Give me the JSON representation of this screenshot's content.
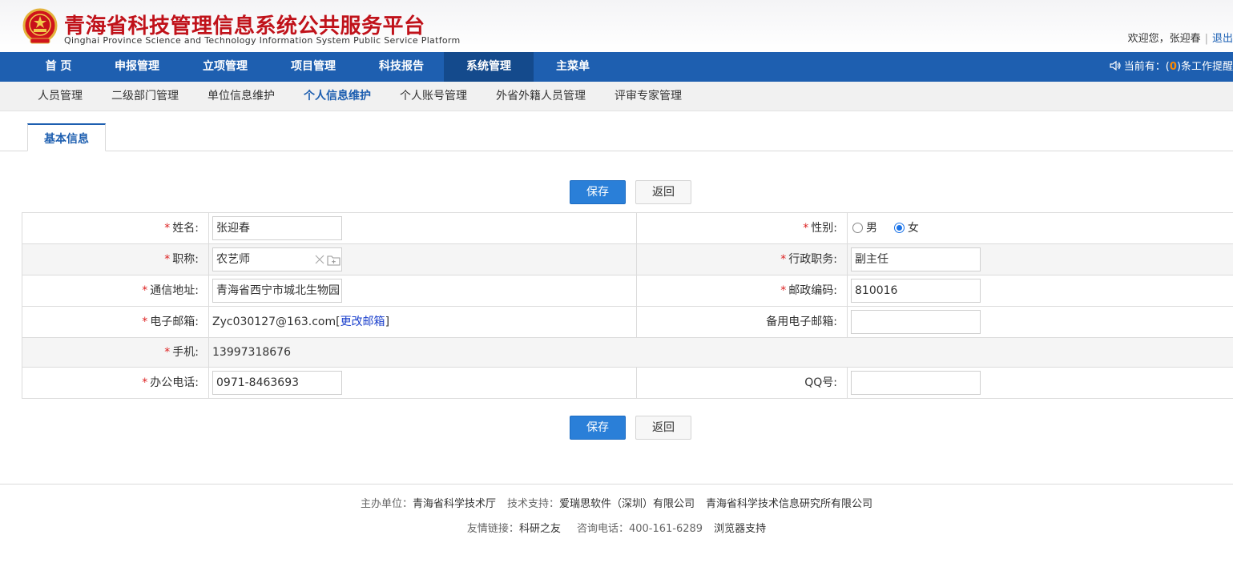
{
  "header": {
    "brand_cn": "青海省科技管理信息系统公共服务平台",
    "brand_en": "Qinghai Province Science and Technology Information System Public Service Platform",
    "welcome": "欢迎您，张迎春",
    "logout": "退出"
  },
  "main_nav": [
    {
      "label": "首 页"
    },
    {
      "label": "申报管理"
    },
    {
      "label": "立项管理"
    },
    {
      "label": "项目管理"
    },
    {
      "label": "科技报告"
    },
    {
      "label": "系统管理",
      "active": true
    },
    {
      "label": "主菜单"
    }
  ],
  "notice": {
    "prefix": "当前有：(",
    "count": "0",
    "suffix": ")条工作提醒"
  },
  "sub_nav": [
    {
      "label": "人员管理"
    },
    {
      "label": "二级部门管理"
    },
    {
      "label": "单位信息维护"
    },
    {
      "label": "个人信息维护",
      "active": true
    },
    {
      "label": "个人账号管理"
    },
    {
      "label": "外省外籍人员管理"
    },
    {
      "label": "评审专家管理"
    }
  ],
  "tab": {
    "label": "基本信息"
  },
  "buttons": {
    "save": "保存",
    "back": "返回"
  },
  "form": {
    "name_label": "姓名:",
    "name_value": "张迎春",
    "gender_label": "性别:",
    "gender_male": "男",
    "gender_female": "女",
    "gender_selected": "女",
    "title_label": "职称:",
    "title_value": "农艺师",
    "admin_post_label": "行政职务:",
    "admin_post_value": "副主任",
    "address_label": "通信地址:",
    "address_value": "青海省西宁市城北生物园",
    "postcode_label": "邮政编码:",
    "postcode_value": "810016",
    "email_label": "电子邮箱:",
    "email_value": "Zyc030127@163.com[",
    "email_change_link": "更改邮箱",
    "email_suffix": "]",
    "backup_email_label": "备用电子邮箱:",
    "backup_email_value": "",
    "mobile_label": "手机:",
    "mobile_value": "13997318676",
    "office_phone_label": "办公电话:",
    "office_phone_value": "0971-8463693",
    "qq_label": "QQ号:",
    "qq_value": ""
  },
  "footer": {
    "host_label": "主办单位：",
    "host_value": "青海省科学技术厅",
    "tech_label": "技术支持：",
    "tech_value1": "爱瑞思软件（深圳）有限公司",
    "tech_value2": "青海省科学技术信息研究所有限公司",
    "links_label": "友情链接：",
    "links_value": "科研之友",
    "consult_label": "咨询电话：",
    "consult_value": "400-161-6289",
    "browser_support": "浏览器支持"
  }
}
